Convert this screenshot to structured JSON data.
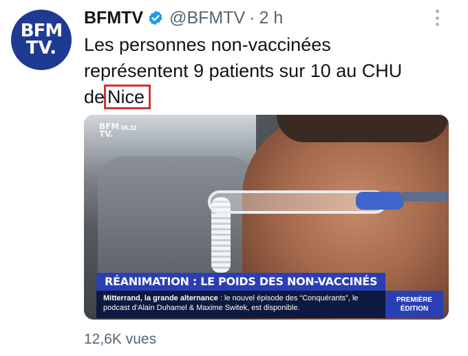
{
  "tweet": {
    "avatar_line1": "BFM",
    "avatar_line2": "TV.",
    "display_name": "BFMTV",
    "handle": "@BFMTV",
    "separator": "·",
    "time": "2 h",
    "text_line1": "Les personnes non-vaccinées",
    "text_line2": "représentent 9 patients sur 10 au CHU",
    "text_line3_prefix": "de",
    "text_highlight": "Nice",
    "views": "12,6K vues"
  },
  "media": {
    "logo_line1": "BFM",
    "logo_line2": "TV.",
    "clock": "06.33",
    "headline": "RÉANIMATION : LE POIDS DES NON-VACCINÉS",
    "ticker_bold": "Mitterrand, la grande alternance",
    "ticker_text": " : le nouvel épisode des “Conquérants”, le podcast d’Alain Duhamel & Maxime Switek, est disponible.",
    "badge_line1": "PREMIÈRE",
    "badge_line2": "ÉDITION"
  },
  "colors": {
    "brand_blue": "#1f3a93",
    "verified_blue": "#1d9bf0",
    "highlight_red": "#d32f2f",
    "muted_text": "#536471"
  },
  "icons": {
    "verified": "verified-badge-icon",
    "more": "more-vertical-icon"
  }
}
